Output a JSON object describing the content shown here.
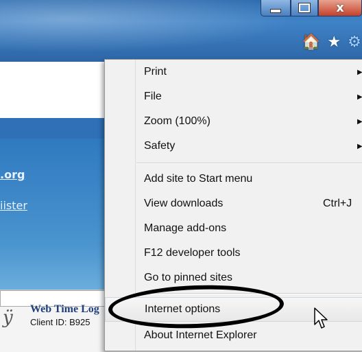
{
  "window": {
    "controls": {
      "minimize_icon": "minimize-icon",
      "maximize_icon": "maximize-icon",
      "close_glyph": "x"
    },
    "toolbar": {
      "home_glyph": "🏠",
      "favorites_glyph": "★",
      "tools_glyph": "⚙"
    }
  },
  "page": {
    "link1": ".org",
    "link2": "iister",
    "logo_glyph": "ÿ",
    "title": "Web Time Log",
    "client": "Client ID: B925"
  },
  "menu": {
    "items": [
      {
        "label": "Print",
        "submenu": true
      },
      {
        "label": "File",
        "submenu": true
      },
      {
        "label": "Zoom (100%)",
        "submenu": true
      },
      {
        "label": "Safety",
        "submenu": true
      },
      {
        "label": "Add site to Start menu"
      },
      {
        "label": "View downloads",
        "shortcut": "Ctrl+J"
      },
      {
        "label": "Manage add-ons"
      },
      {
        "label": "F12 developer tools"
      },
      {
        "label": "Go to pinned sites"
      },
      {
        "label": "Internet options"
      },
      {
        "label": "About Internet Explorer"
      }
    ],
    "submenu_arrow": "▶"
  },
  "colors": {
    "chrome": "#3f82c6",
    "menu_bg": "#f1f1f1",
    "link": "#e8f3ff",
    "title": "#1f3f7a"
  }
}
